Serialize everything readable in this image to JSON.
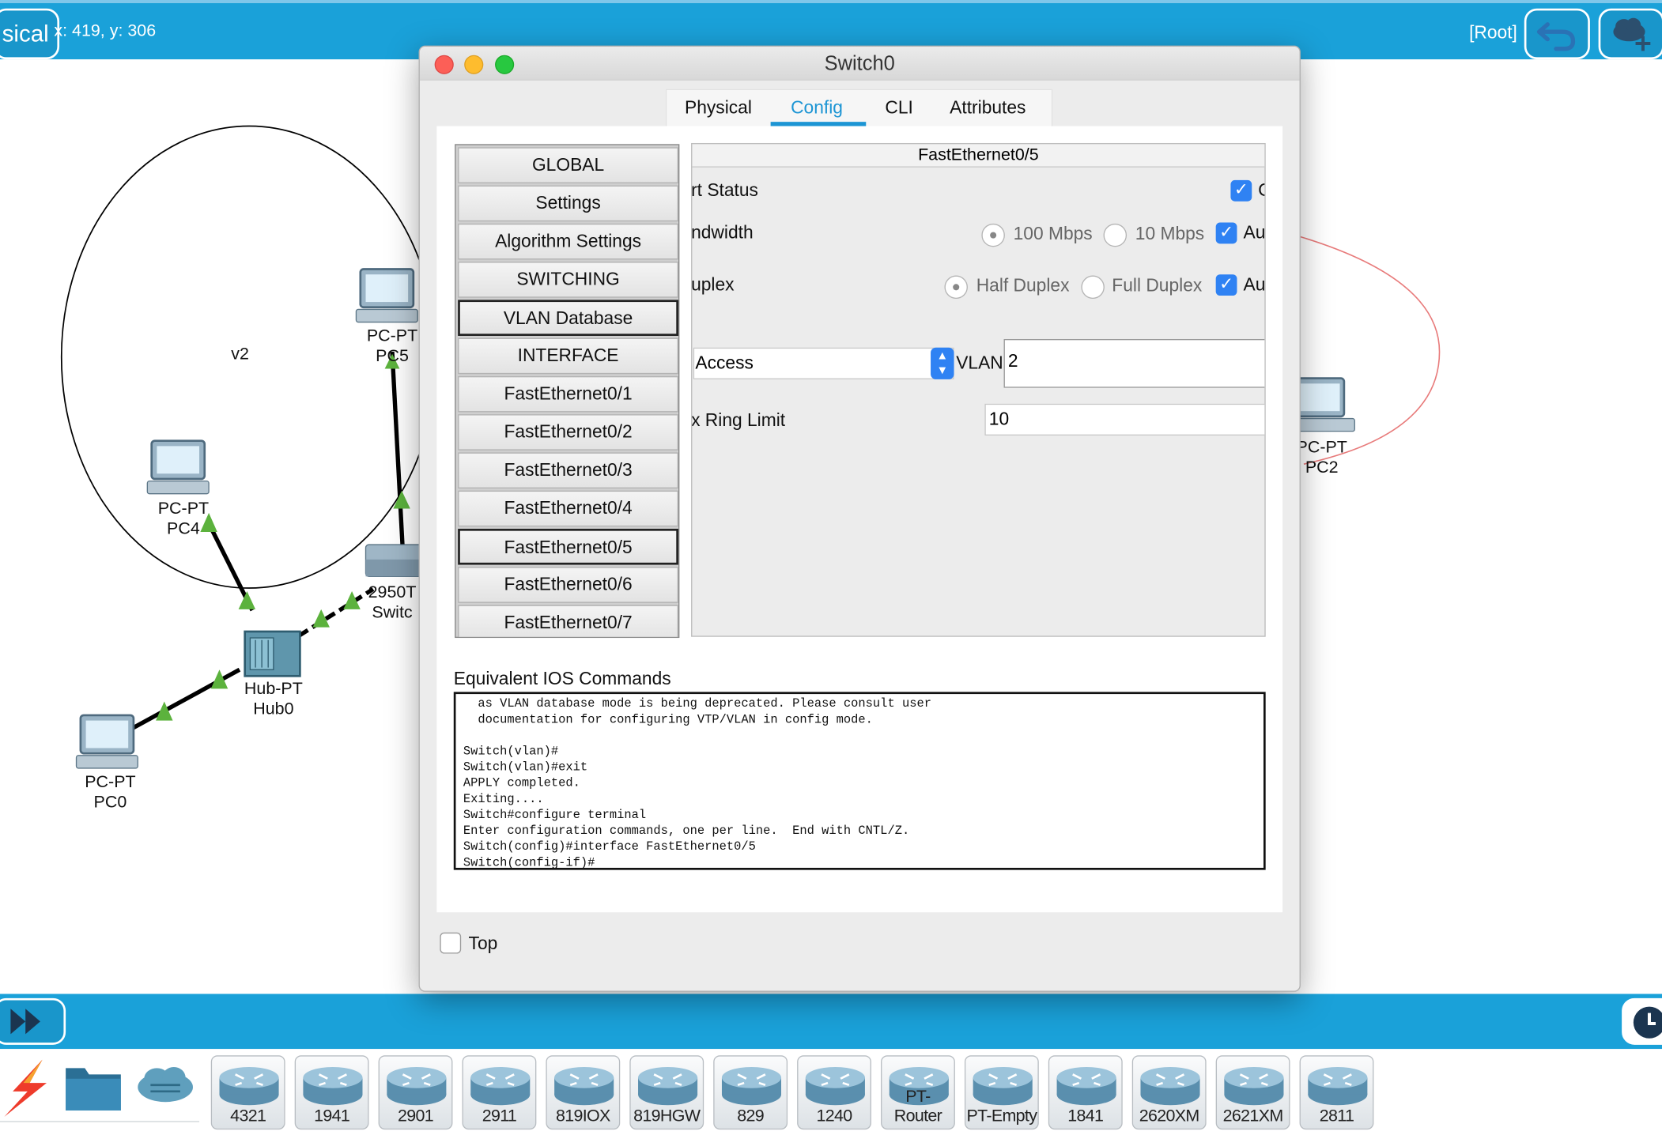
{
  "topbar": {
    "mode_label": "sical",
    "coords": "x: 419, y: 306",
    "root_label": "[Root]",
    "buttons": [
      "back-icon",
      "cloud-add-icon"
    ]
  },
  "canvas": {
    "cluster_label": "v2",
    "nodes": [
      {
        "id": "pc5",
        "line1": "PC-PT",
        "line2": "PC5"
      },
      {
        "id": "pc4",
        "line1": "PC-PT",
        "line2": "PC4"
      },
      {
        "id": "pc0",
        "line1": "PC-PT",
        "line2": "PC0"
      },
      {
        "id": "pc2",
        "line1": "PC-PT",
        "line2": "PC2"
      },
      {
        "id": "hub0",
        "line1": "Hub-PT",
        "line2": "Hub0"
      },
      {
        "id": "switch0",
        "line1": "2950T",
        "line2": "Switc"
      }
    ],
    "link_colors": {
      "link": "#000000",
      "status_up": "#5cb23d",
      "cluster_v3": "#e87b7b"
    }
  },
  "dialog": {
    "title": "Switch0",
    "tabs": [
      "Physical",
      "Config",
      "CLI",
      "Attributes"
    ],
    "active_tab": "Config",
    "sidebar": [
      "GLOBAL",
      "Settings",
      "Algorithm Settings",
      "SWITCHING",
      "VLAN Database",
      "INTERFACE",
      "FastEthernet0/1",
      "FastEthernet0/2",
      "FastEthernet0/3",
      "FastEthernet0/4",
      "FastEthernet0/5",
      "FastEthernet0/6",
      "FastEthernet0/7"
    ],
    "selected_item": "FastEthernet0/5",
    "interface": {
      "header": "FastEthernet0/5",
      "port_status_label": "rt Status",
      "port_status_checked": true,
      "port_status_on_label": "O",
      "bandwidth_label": "ndwidth",
      "bandwidth_opt1": "100 Mbps",
      "bandwidth_opt2": "10 Mbps",
      "bandwidth_auto": "Au",
      "duplex_label": "uplex",
      "duplex_opt1": "Half Duplex",
      "duplex_opt2": "Full Duplex",
      "duplex_auto": "Au",
      "mode_value": "Access",
      "vlan_label": "VLAN",
      "vlan_value": "2",
      "ring_label": "x Ring Limit",
      "ring_value": "10"
    },
    "ios_title": "Equivalent IOS Commands",
    "ios_lines": [
      "  as VLAN database mode is being deprecated. Please consult user",
      "  documentation for configuring VTP/VLAN in config mode.",
      "",
      "Switch(vlan)#",
      "Switch(vlan)#exit",
      "APPLY completed.",
      "Exiting....",
      "Switch#configure terminal",
      "Enter configuration commands, one per line.  End with CNTL/Z.",
      "Switch(config)#interface FastEthernet0/5",
      "Switch(config-if)#"
    ],
    "top_checkbox_label": "Top"
  },
  "palette": {
    "category_icons": [
      "lightning-icon",
      "folder-icon",
      "cloud-icon"
    ],
    "devices": [
      "4321",
      "1941",
      "2901",
      "2911",
      "819IOX",
      "819HGW",
      "829",
      "1240",
      "PT-Router",
      "PT-Empty",
      "1841",
      "2620XM",
      "2621XM",
      "2811"
    ]
  }
}
